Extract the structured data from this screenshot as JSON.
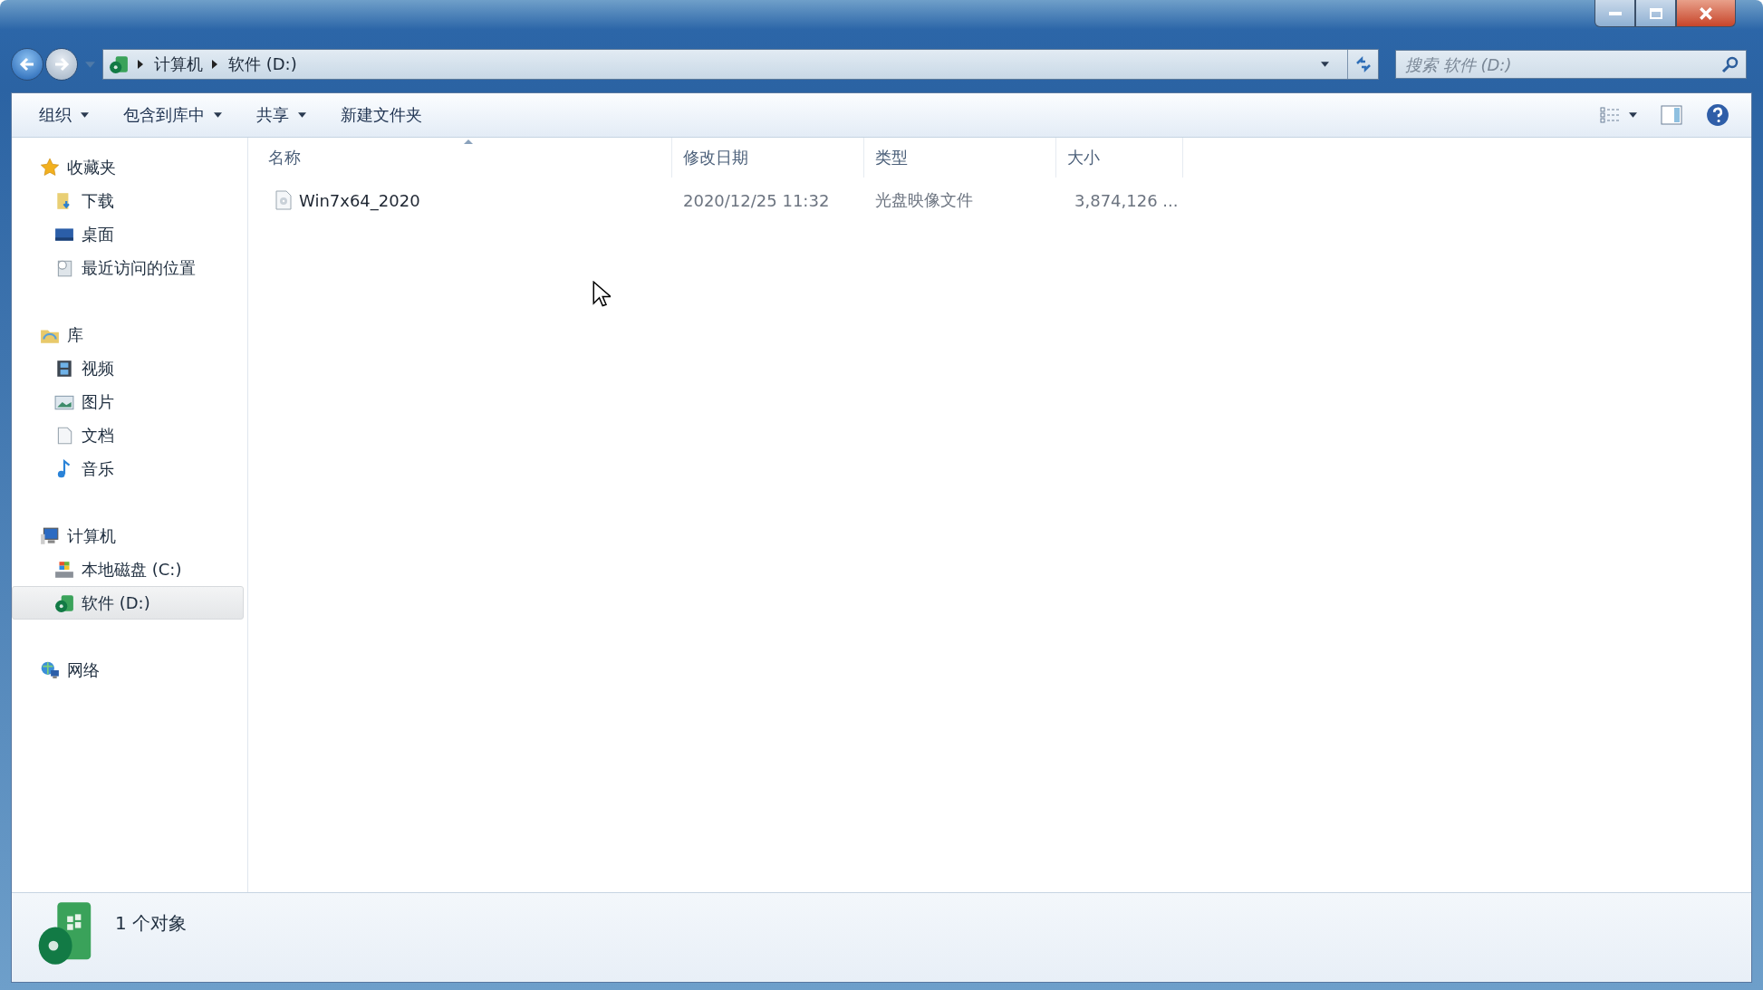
{
  "address_bar": {
    "crumbs": [
      "计算机",
      "软件 (D:)"
    ]
  },
  "search": {
    "placeholder": "搜索 软件 (D:)"
  },
  "toolbar": {
    "buttons": [
      {
        "label": "组织",
        "dropdown": true
      },
      {
        "label": "包含到库中",
        "dropdown": true
      },
      {
        "label": "共享",
        "dropdown": true
      },
      {
        "label": "新建文件夹",
        "dropdown": false
      }
    ]
  },
  "sidebar": {
    "sections": [
      {
        "label": "收藏夹",
        "kind": "star",
        "children": [
          {
            "label": "下载",
            "kind": "download",
            "selected": false
          },
          {
            "label": "桌面",
            "kind": "desktop",
            "selected": false
          },
          {
            "label": "最近访问的位置",
            "kind": "recent",
            "selected": false
          }
        ]
      },
      {
        "label": "库",
        "kind": "library",
        "children": [
          {
            "label": "视频",
            "kind": "video",
            "selected": false
          },
          {
            "label": "图片",
            "kind": "picture",
            "selected": false
          },
          {
            "label": "文档",
            "kind": "document",
            "selected": false
          },
          {
            "label": "音乐",
            "kind": "music",
            "selected": false
          }
        ]
      },
      {
        "label": "计算机",
        "kind": "computer",
        "children": [
          {
            "label": "本地磁盘 (C:)",
            "kind": "drive-c",
            "selected": false
          },
          {
            "label": "软件 (D:)",
            "kind": "drive-d",
            "selected": true
          }
        ]
      },
      {
        "label": "网络",
        "kind": "network"
      }
    ]
  },
  "table": {
    "columns": [
      "名称",
      "修改日期",
      "类型",
      "大小"
    ],
    "rows": [
      {
        "name": "Win7x64_2020",
        "modified": "2020/12/25 11:32",
        "type": "光盘映像文件",
        "size": "3,874,126 ..."
      }
    ]
  },
  "status_bar": {
    "text": "1 个对象"
  }
}
